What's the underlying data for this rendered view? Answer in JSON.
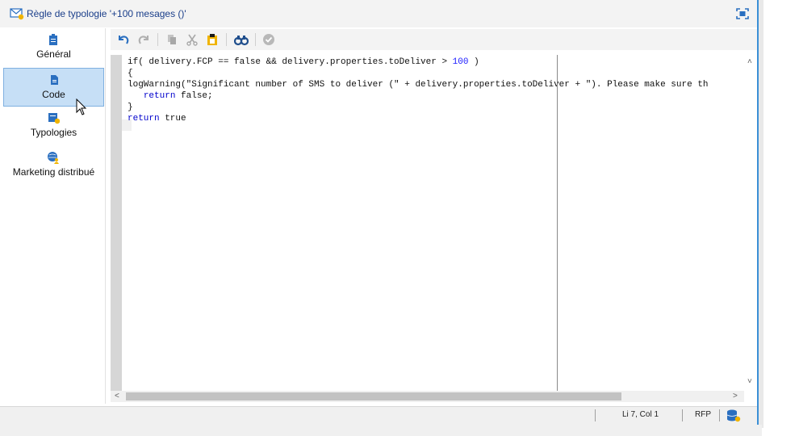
{
  "window": {
    "title": "Règle de typologie '+100 mesages ()'"
  },
  "sidebar": {
    "items": [
      {
        "label": "Général",
        "icon": "clipboard-icon"
      },
      {
        "label": "Code",
        "icon": "document-icon",
        "selected": true
      },
      {
        "label": "Typologies",
        "icon": "typology-icon"
      },
      {
        "label": "Marketing distribué",
        "icon": "globe-user-icon"
      }
    ]
  },
  "toolbar": {
    "buttons": [
      "undo-icon",
      "redo-icon",
      "copy-icon",
      "cut-icon",
      "paste-icon",
      "find-icon",
      "check-icon"
    ]
  },
  "code": {
    "line1_a": "if( delivery.FCP == false && delivery.properties.toDeliver > ",
    "line1_num": "100",
    "line1_b": " )",
    "line2": "{",
    "line3": "logWarning(\"Significant number of SMS to deliver (\" + delivery.properties.toDeliver + \"). Please make sure th",
    "line4_indent": "   ",
    "line4_kw": "return",
    "line4_rest": " false;",
    "line5": "}",
    "line6_kw": "return",
    "line6_rest": " true"
  },
  "status": {
    "position": "Li 7, Col 1",
    "mode": "RFP"
  },
  "colors": {
    "accent": "#3a8fd6",
    "selection": "#c6dff6",
    "keyword": "#0000cc"
  }
}
